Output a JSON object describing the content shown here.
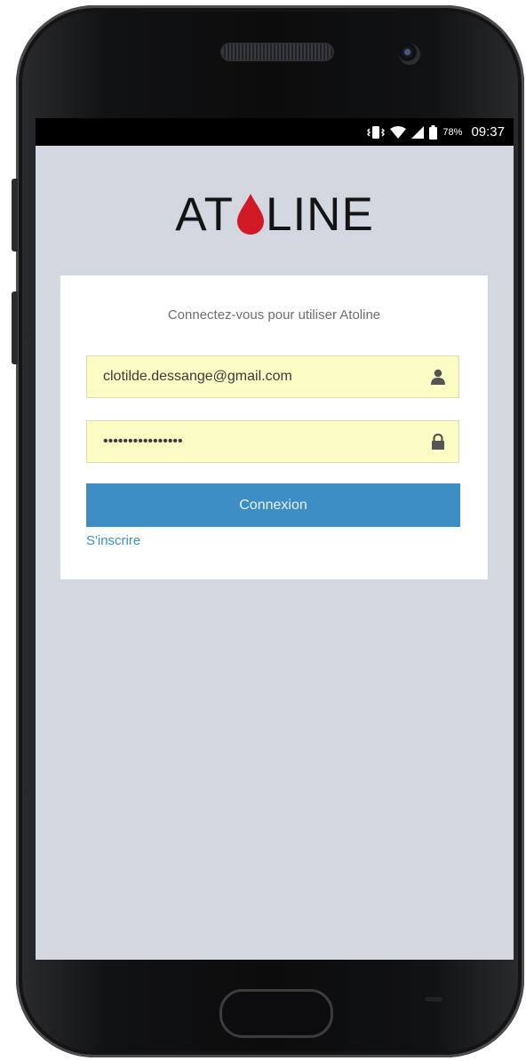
{
  "status_bar": {
    "battery_percent": "78%",
    "time": "09:37"
  },
  "logo": {
    "text_left": "AT",
    "text_right": "LINE",
    "drop_color": "#d21a26"
  },
  "login": {
    "prompt": "Connectez-vous pour utiliser Atoline",
    "email_value": "clotilde.dessange@gmail.com",
    "password_value": "••••••••••••••••",
    "submit_label": "Connexion",
    "signup_label": "S'inscrire"
  },
  "colors": {
    "screen_bg": "#d3d7df",
    "autofill_bg": "#fbfcc3",
    "primary": "#3d8ec4"
  },
  "icons": {
    "email": "user-icon",
    "password": "lock-icon"
  }
}
